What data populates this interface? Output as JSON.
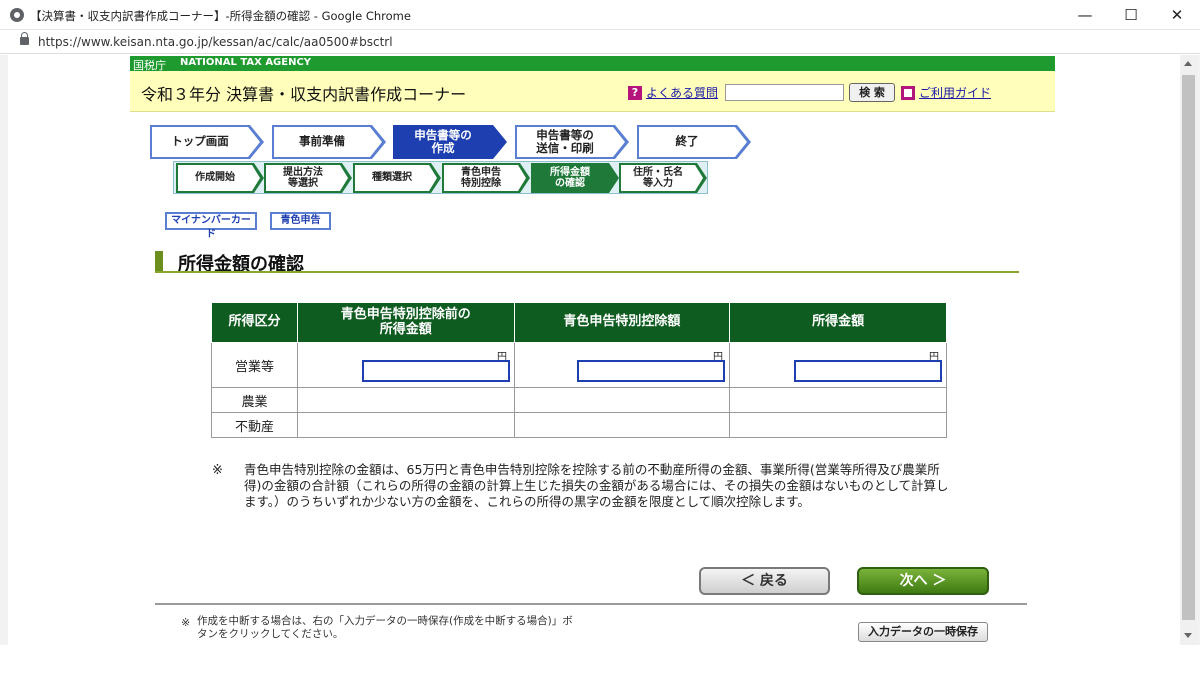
{
  "browser": {
    "window_title": "【決算書・収支内訳書作成コーナー】-所得金額の確認 - Google Chrome",
    "url": "https://www.keisan.nta.go.jp/kessan/ac/calc/aa0500#bsctrl",
    "minimize": "—",
    "maximize": "☐",
    "close": "✕"
  },
  "header": {
    "agency_jp": "国税庁",
    "agency_en": "NATIONAL TAX AGENCY",
    "page_title": "令和３年分 決算書・収支内訳書作成コーナー",
    "faq_icon": "?",
    "faq_link": "よくある質問",
    "search_placeholder": "",
    "search_button": "検 索",
    "guide_link": "ご利用ガイド"
  },
  "steps_main": [
    {
      "label": "トップ画面",
      "state": "normal"
    },
    {
      "label": "事前準備",
      "state": "normal"
    },
    {
      "label": "申告書等の\n作成",
      "state": "active"
    },
    {
      "label": "申告書等の\n送信・印刷",
      "state": "normal"
    },
    {
      "label": "終了",
      "state": "normal"
    }
  ],
  "steps_sub": [
    {
      "label": "作成開始",
      "state": "normal"
    },
    {
      "label": "提出方法\n等選択",
      "state": "normal"
    },
    {
      "label": "種類選択",
      "state": "normal"
    },
    {
      "label": "青色申告\n特別控除",
      "state": "normal"
    },
    {
      "label": "所得金額\nの確認",
      "state": "active"
    },
    {
      "label": "住所・氏名\n等入力",
      "state": "normal"
    }
  ],
  "tags": {
    "mynumber": "マイナンバーカード",
    "blue": "青色申告"
  },
  "section": {
    "title": "所得金額の確認"
  },
  "table": {
    "headers": [
      "所得区分",
      "青色申告特別控除前の\n所得金額",
      "青色申告特別控除額",
      "所得金額"
    ],
    "rows": [
      {
        "label": "営業等",
        "values": [
          "",
          "",
          ""
        ]
      },
      {
        "label": "農業"
      },
      {
        "label": "不動産"
      }
    ],
    "yen_unit": "円"
  },
  "note": {
    "mark": "※",
    "text": "青色申告特別控除の金額は、65万円と青色申告特別控除を控除する前の不動産所得の金額、事業所得(営業等所得及び農業所得)の金額の合計額（これらの所得の金額の計算上生じた損失の金額がある場合には、その損失の金額はないものとして計算します。）のうちいずれか少ない方の金額を、これらの所得の黒字の金額を限度として順次控除します。"
  },
  "buttons": {
    "back": "＜ 戻る",
    "next": "次へ ＞",
    "save": "入力データの一時保存"
  },
  "footer": {
    "mark": "※",
    "text": "作成を中断する場合は、右の「入力データの一時保存(作成を中断する場合)」ボタンをクリックしてください。"
  },
  "colors": {
    "agency_green": "#1f9a2f",
    "header_yellow": "#ffffbb",
    "step_blue": "#1e3fb0",
    "step_green": "#1f7a3a",
    "table_header_green": "#0f5c20"
  }
}
